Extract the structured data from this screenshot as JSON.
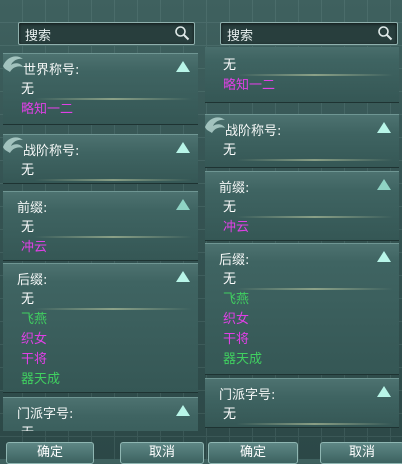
{
  "colors": {
    "none": "#ffffff",
    "magenta": "#e040e6",
    "green": "#40d060"
  },
  "left": {
    "search_placeholder": "搜索",
    "categories": [
      {
        "title": "世界称号:",
        "items": [
          {
            "text": "无",
            "color": "none"
          },
          {
            "text": "略知一二",
            "color": "magenta"
          }
        ]
      },
      {
        "title": "战阶称号:",
        "items": [
          {
            "text": "无",
            "color": "none"
          }
        ]
      },
      {
        "title": "前缀:",
        "items": [
          {
            "text": "无",
            "color": "none"
          },
          {
            "text": "冲云",
            "color": "magenta"
          }
        ]
      },
      {
        "title": "后缀:",
        "items": [
          {
            "text": "无",
            "color": "none"
          },
          {
            "text": "飞燕",
            "color": "green"
          },
          {
            "text": "织女",
            "color": "magenta"
          },
          {
            "text": "干将",
            "color": "magenta"
          },
          {
            "text": "器天成",
            "color": "green"
          }
        ]
      },
      {
        "title": "门派字号:",
        "items": [
          {
            "text": "无",
            "color": "none"
          }
        ]
      }
    ],
    "confirm": "确定",
    "cancel": "取消"
  },
  "right": {
    "search_placeholder": "搜索",
    "partial_items": [
      {
        "text": "无",
        "color": "none"
      },
      {
        "text": "略知一二",
        "color": "magenta"
      }
    ],
    "categories": [
      {
        "title": "战阶称号:",
        "items": [
          {
            "text": "无",
            "color": "none"
          }
        ]
      },
      {
        "title": "前缀:",
        "items": [
          {
            "text": "无",
            "color": "none"
          },
          {
            "text": "冲云",
            "color": "magenta"
          }
        ]
      },
      {
        "title": "后缀:",
        "items": [
          {
            "text": "无",
            "color": "none"
          },
          {
            "text": "飞燕",
            "color": "green"
          },
          {
            "text": "织女",
            "color": "magenta"
          },
          {
            "text": "干将",
            "color": "magenta"
          },
          {
            "text": "器天成",
            "color": "green"
          }
        ]
      },
      {
        "title": "门派字号:",
        "items": [
          {
            "text": "无",
            "color": "none"
          }
        ]
      }
    ],
    "confirm": "确定",
    "cancel": "取消"
  }
}
